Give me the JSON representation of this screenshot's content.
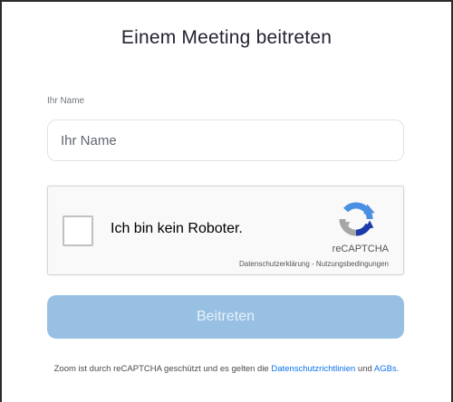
{
  "page": {
    "title": "Einem Meeting beitreten"
  },
  "name_field": {
    "label": "Ihr Name",
    "placeholder": "Ihr Name",
    "value": ""
  },
  "recaptcha": {
    "checkbox_label": "Ich bin kein Roboter.",
    "brand": "reCAPTCHA",
    "privacy_link": "Datenschutzerklärung",
    "separator": " - ",
    "terms_link": "Nutzungsbedingungen",
    "logo_icon": "recaptcha-logo-icon",
    "checked": false
  },
  "join_button": {
    "label": "Beitreten",
    "enabled": false
  },
  "footer": {
    "text_before": "Zoom ist durch reCAPTCHA geschützt und es gelten die ",
    "privacy_link": "Datenschutzrichtlinien",
    "text_middle": " und ",
    "terms_link": "AGBs",
    "text_after": "."
  },
  "colors": {
    "button_disabled": "#98c0e3",
    "link": "#0e72ed",
    "recaptcha_blue": "#4a90e2",
    "recaptcha_dark_blue": "#1c3aa9",
    "recaptcha_gray": "#a6a6a6"
  }
}
